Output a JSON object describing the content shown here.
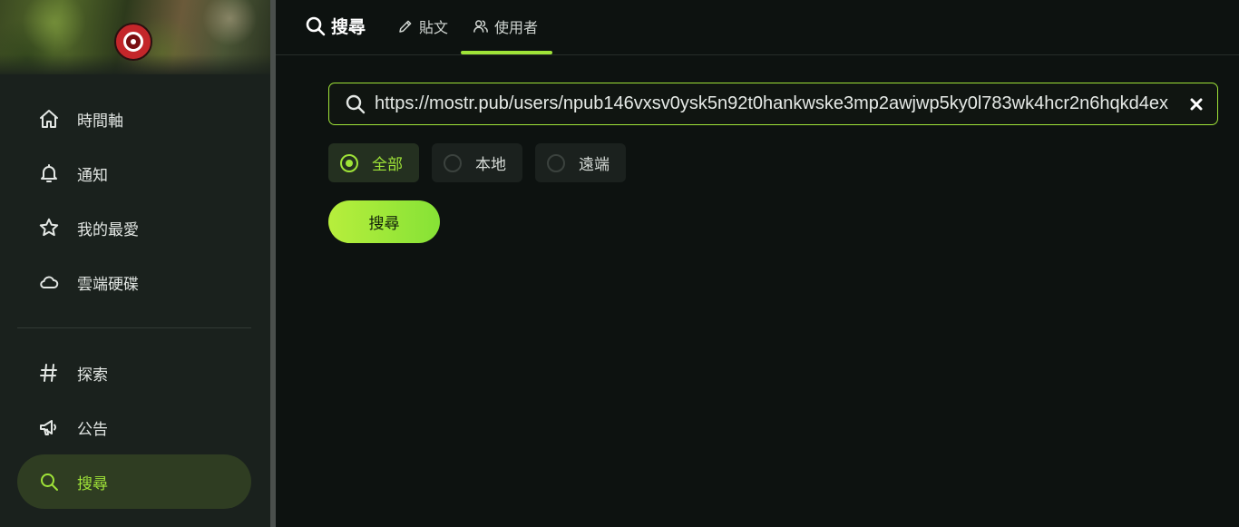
{
  "sidebar": {
    "items": [
      {
        "label": "時間軸",
        "icon": "home-icon"
      },
      {
        "label": "通知",
        "icon": "bell-icon"
      },
      {
        "label": "我的最愛",
        "icon": "star-icon"
      },
      {
        "label": "雲端硬碟",
        "icon": "cloud-icon"
      },
      {
        "label": "探索",
        "icon": "hashtag-icon"
      },
      {
        "label": "公告",
        "icon": "megaphone-icon"
      },
      {
        "label": "搜尋",
        "icon": "search-icon",
        "active": true
      }
    ]
  },
  "header": {
    "title": "搜尋",
    "tabs": [
      {
        "label": "貼文",
        "icon": "pencil-icon"
      },
      {
        "label": "使用者",
        "icon": "users-icon",
        "active": true
      }
    ]
  },
  "search": {
    "value": "https://mostr.pub/users/npub146vxsv0ysk5n92t0hankwske3mp2awjwp5ky0l783wk4hcr2n6hqkd4ex"
  },
  "scope": {
    "options": [
      "全部",
      "本地",
      "遠端"
    ],
    "selected": "全部"
  },
  "submit_label": "搜尋",
  "colors": {
    "accent": "#9fe338",
    "background": "#0d1210",
    "sidebar": "#1a211d"
  }
}
